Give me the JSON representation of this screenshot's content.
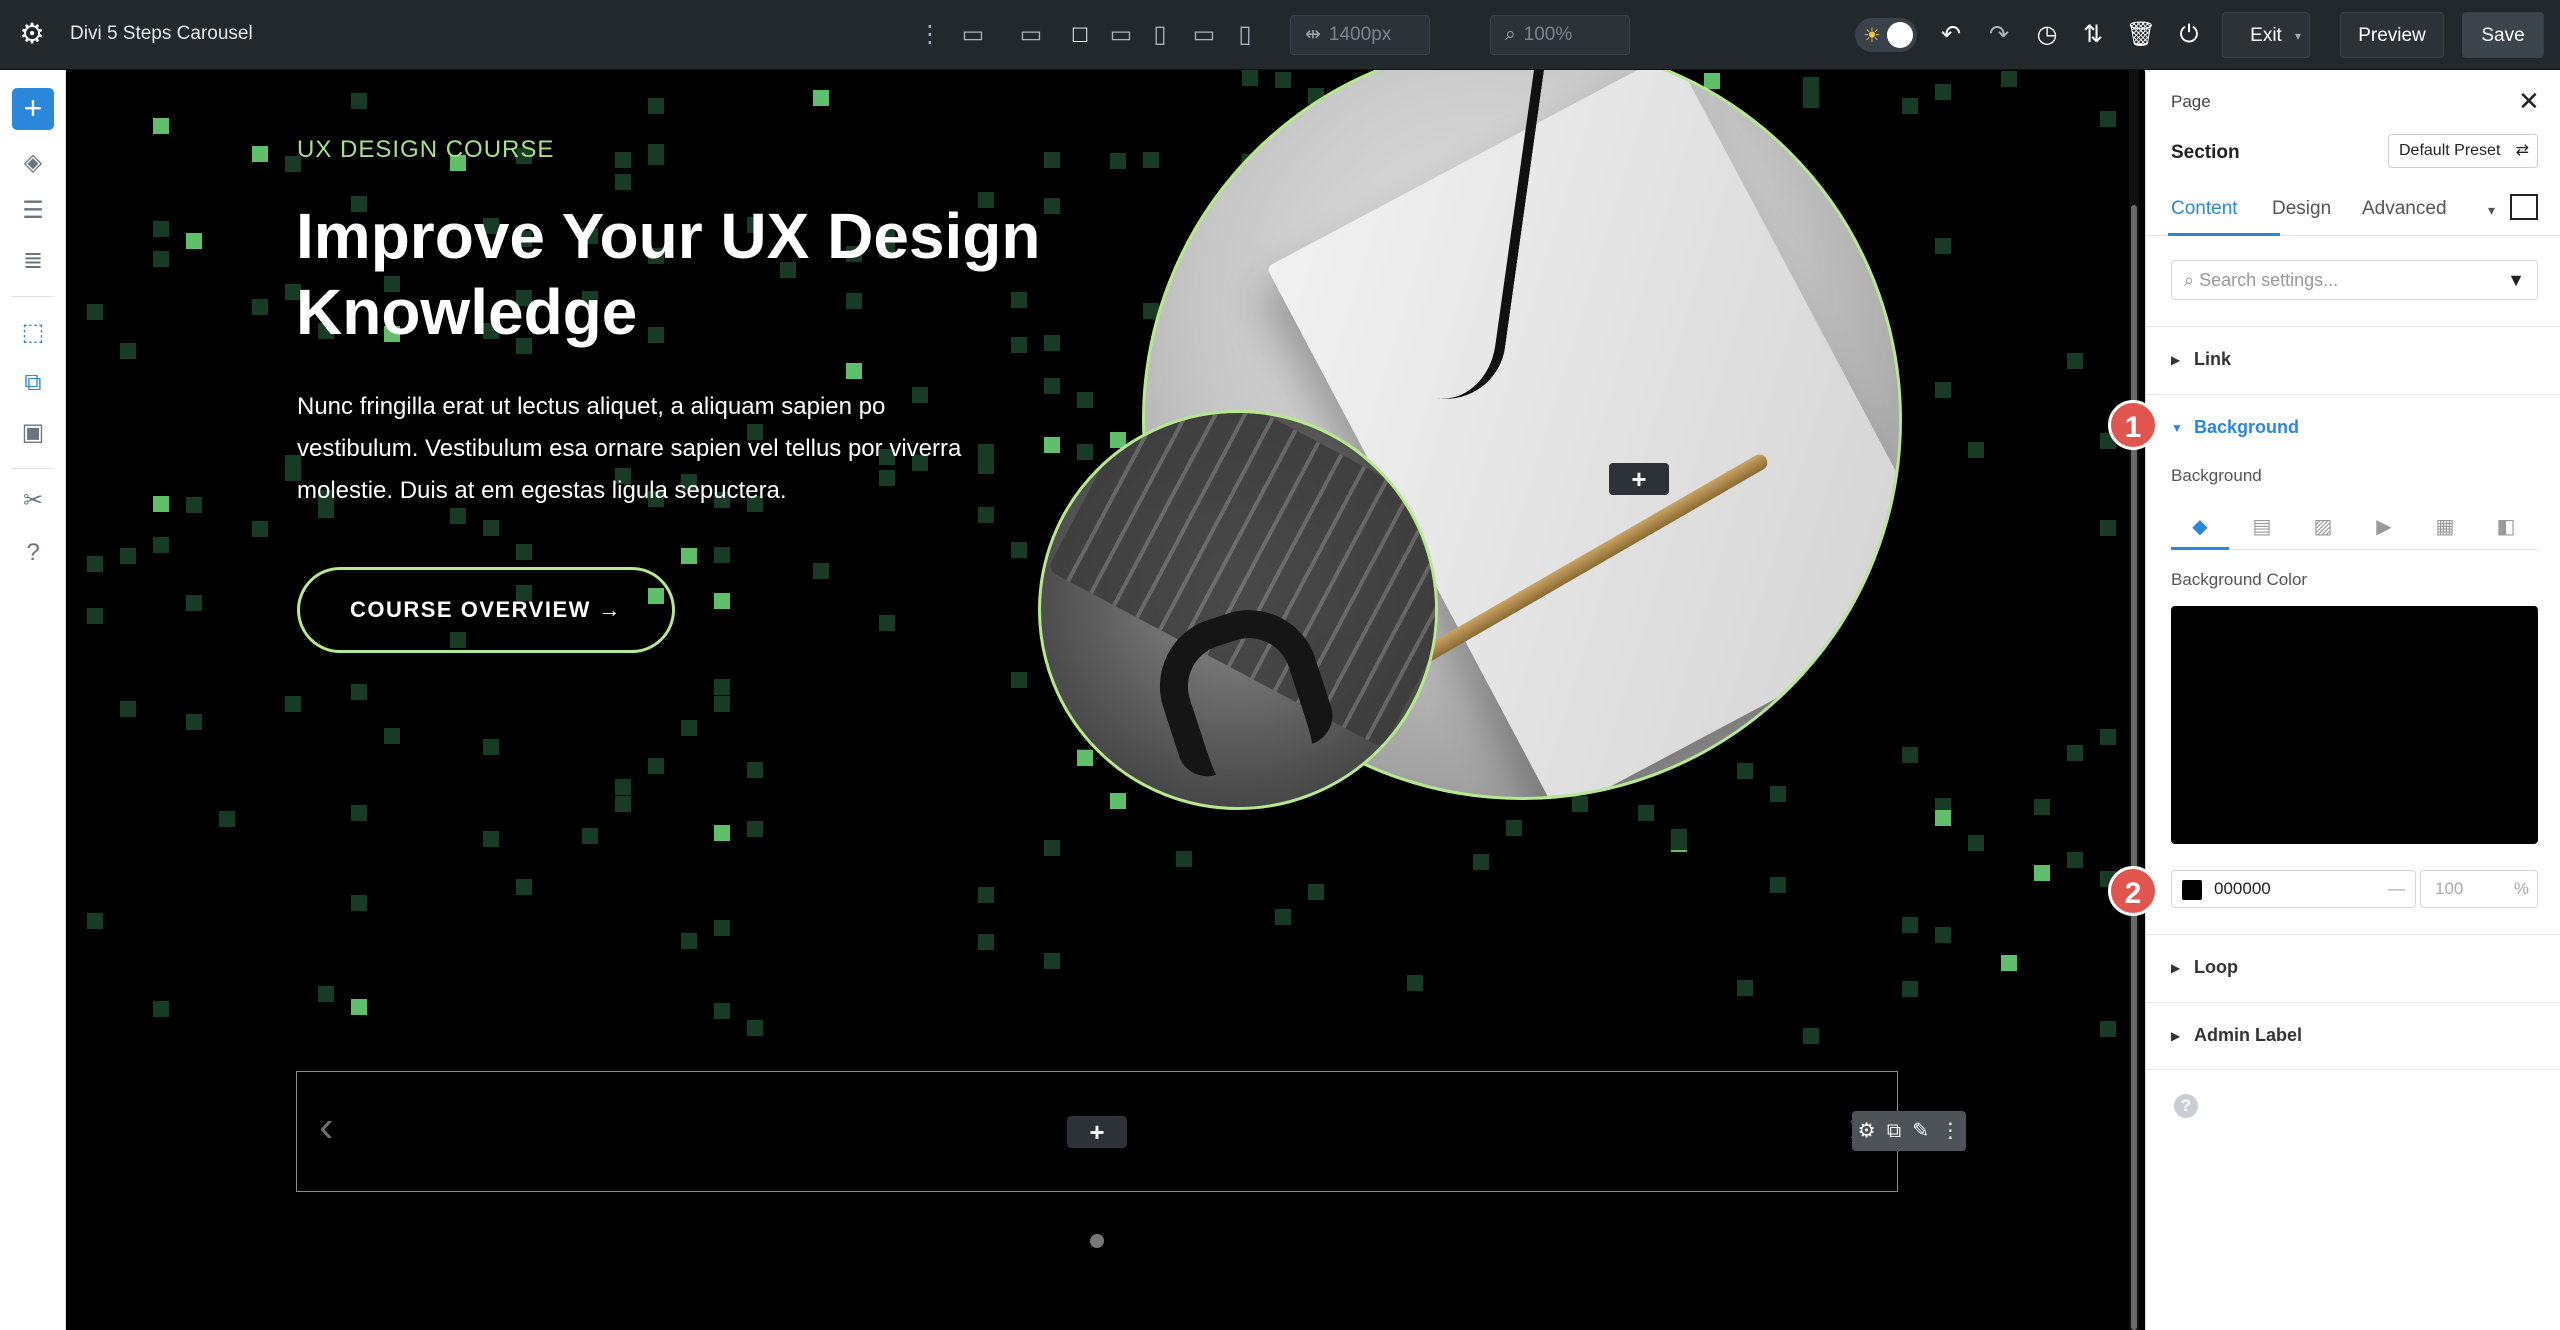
{
  "app": {
    "title": "Divi 5 Steps Carousel"
  },
  "toolbar": {
    "width_value": "1400px",
    "zoom_value": "100%",
    "exit_label": "Exit",
    "preview_label": "Preview",
    "save_label": "Save"
  },
  "hero": {
    "eyebrow": "UX DESIGN COURSE",
    "headline_line1": "Improve Your UX Design",
    "headline_line2": "Knowledge",
    "body_line1": "Nunc fringilla erat ut lectus aliquet, a aliquam sapien po",
    "body_line2": "vestibulum. Vestibulum esa ornare sapien vel tellus por viverra",
    "body_line3": "molestie. Duis at em egestas ligula sepuctera.",
    "cta_label": "COURSE OVERVIEW →",
    "accent_color": "#b6e98e"
  },
  "canvas": {
    "add_symbol": "+",
    "prev_symbol": "‹",
    "next_symbol": "›"
  },
  "panel": {
    "title": "Page",
    "section_label": "Section",
    "preset_label": "Default Preset",
    "tabs": [
      "Content",
      "Design",
      "Advanced"
    ],
    "search_placeholder": "Search settings...",
    "groups": {
      "link": "Link",
      "background": "Background",
      "loop": "Loop",
      "admin_label": "Admin Label"
    },
    "background_sub_label": "Background",
    "background_color_label": "Background Color",
    "color_hex": "000000",
    "color_dash": "—",
    "opacity_placeholder": "100",
    "opacity_unit": "%"
  },
  "badges": [
    "1",
    "2"
  ]
}
